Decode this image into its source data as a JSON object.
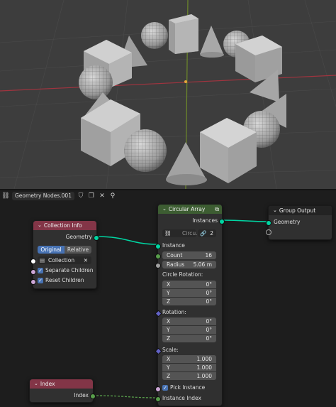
{
  "viewport": {
    "background": "#3d3d3d",
    "x_axis_color": "#a0343f",
    "y_axis_color": "#6e8a2a"
  },
  "editor_header": {
    "editor_type_icon": "node-editor-icon",
    "tree_name": "Geometry Nodes.001",
    "icons": [
      "shield-icon",
      "duplicate-icon",
      "close-icon",
      "pin-icon"
    ],
    "close_glyph": "✕",
    "pin_glyph": "📌"
  },
  "collection_info": {
    "title": "Collection Info",
    "output_geometry": "Geometry",
    "mode_options": [
      "Original",
      "Relative"
    ],
    "mode_selected": "Original",
    "collection_label": "Collection",
    "clear_glyph": "✕",
    "separate_children": "Separate Children",
    "reset_children": "Reset Children",
    "check_glyph": "✓"
  },
  "circular_array": {
    "title": "Circular Array",
    "output_instances": "Instances",
    "group_field_label": "Circu...",
    "user_count": "2",
    "instance_label": "Instance",
    "count_label": "Count",
    "count_value": "16",
    "radius_label": "Radius",
    "radius_value": "5.06 m",
    "circle_rotation_label": "Circle Rotation:",
    "circle_rotation": [
      {
        "axis": "X",
        "value": "0°"
      },
      {
        "axis": "Y",
        "value": "0°"
      },
      {
        "axis": "Z",
        "value": "0°"
      }
    ],
    "rotation_label": "Rotation:",
    "rotation": [
      {
        "axis": "X",
        "value": "0°"
      },
      {
        "axis": "Y",
        "value": "0°"
      },
      {
        "axis": "Z",
        "value": "0°"
      }
    ],
    "scale_label": "Scale:",
    "scale": [
      {
        "axis": "X",
        "value": "1.000"
      },
      {
        "axis": "Y",
        "value": "1.000"
      },
      {
        "axis": "Z",
        "value": "1.000"
      }
    ],
    "pick_instance": "Pick Instance",
    "instance_index": "Instance Index"
  },
  "group_output": {
    "title": "Group Output",
    "input_geometry": "Geometry"
  },
  "index_node": {
    "title": "Index",
    "output_index": "Index"
  },
  "colors": {
    "geometry_socket": "#00d6a3",
    "integer_socket": "#589e4b",
    "node_header_input": "#833547",
    "node_header_group": "#3d5d32"
  }
}
